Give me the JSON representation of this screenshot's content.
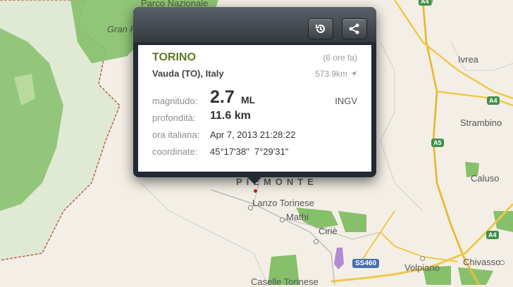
{
  "popup": {
    "history_icon": "history-icon",
    "share_icon": "share-icon",
    "city": "TORINO",
    "time_ago": "(6 ore fa)",
    "place": "Vauda (TO), Italy",
    "distance": "573.9km",
    "distance_icon": "location-arrow-icon",
    "magnitude_label": "magnitudo:",
    "magnitude_value": "2.7",
    "magnitude_unit": "ML",
    "source": "INGV",
    "depth_label": "profondità:",
    "depth_value": "11.6 km",
    "time_label": "ora italiana:",
    "time_value": "Apr 7, 2013 21:28:22",
    "coords_label": "coordinate:",
    "coords_value": "45°17'38\"  7°29'31\""
  },
  "map": {
    "labels": {
      "parco": "Parco Nazionale",
      "gran": "Gran P",
      "ivrea": "Ivrea",
      "strambino": "Strambino",
      "caluso": "Caluso",
      "piemonte": "PIEMONTE",
      "lanzo": "Lanzo Torinese",
      "mathi": "Mathi",
      "cirie": "Ciriè",
      "volpiano": "Volpiano",
      "chivasso": "Chivasso",
      "caselle": "Caselle Torinese"
    },
    "shields": {
      "a4_top": "A4",
      "a5": "A5",
      "a4_mid": "A4",
      "a4_bottom": "A4",
      "ss460": "SS460"
    },
    "colors": {
      "park": "#86c06a",
      "road": "#f0c84a",
      "region": "#dfe9d4"
    }
  }
}
